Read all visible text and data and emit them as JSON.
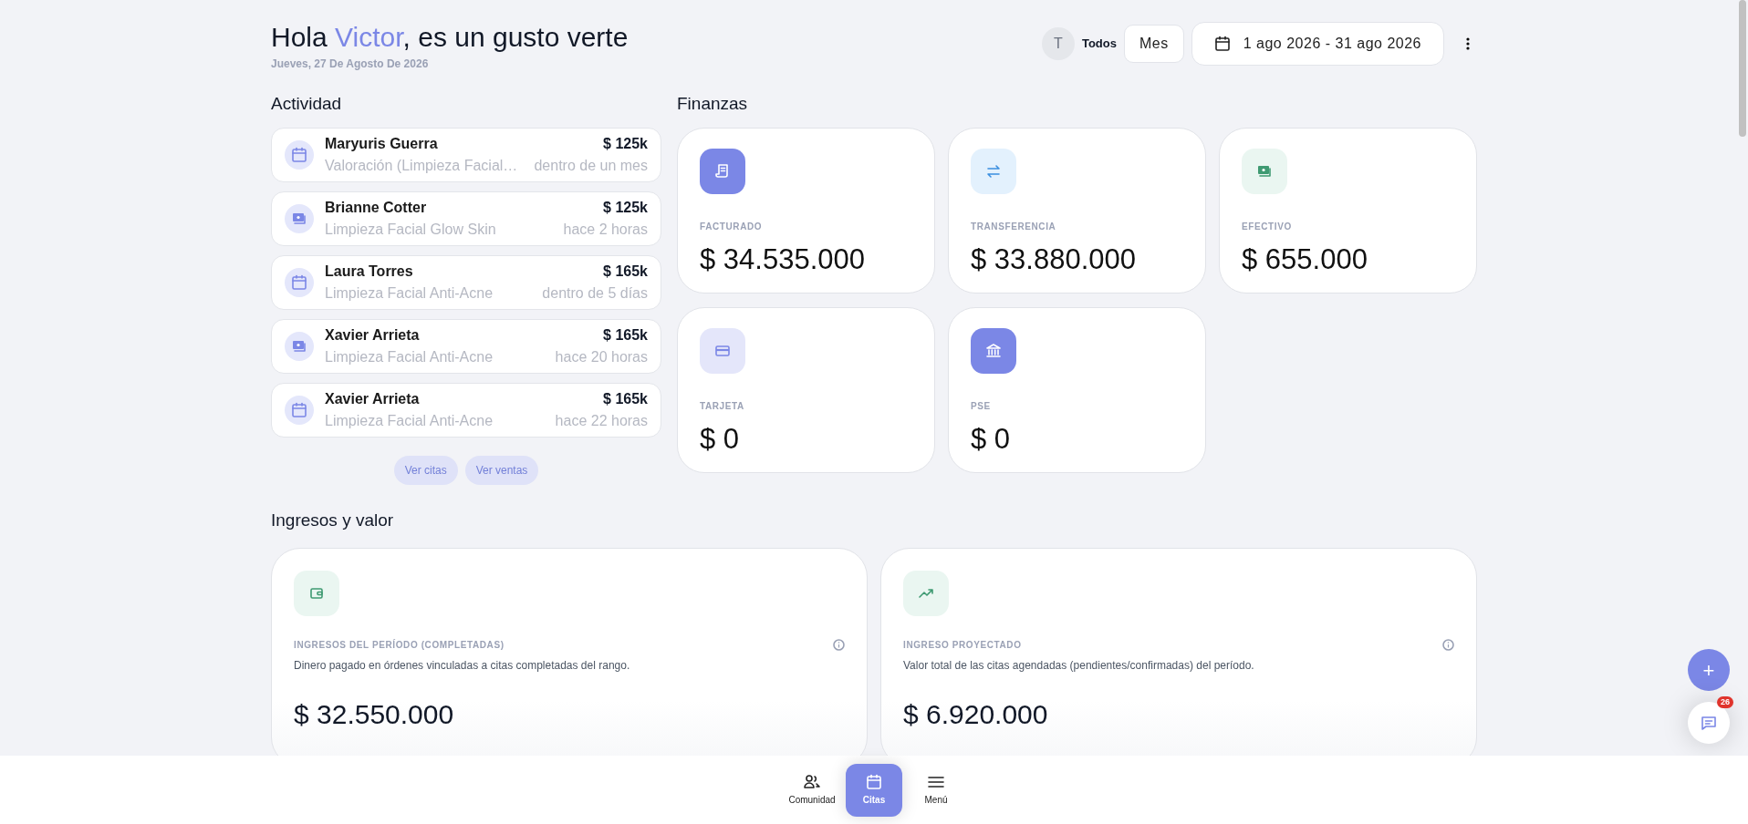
{
  "header": {
    "greeting_prefix": "Hola ",
    "user_name": "Victor",
    "greeting_suffix": ", es un gusto verte",
    "date": "Jueves, 27 De Agosto De 2026"
  },
  "filters": {
    "avatar_initial": "T",
    "scope": "Todos",
    "period": "Mes",
    "date_range": "1 ago 2026 - 31 ago 2026"
  },
  "activity": {
    "title": "Actividad",
    "items": [
      {
        "kind": "appointment",
        "name": "Maryuris Guerra",
        "amount": "$ 125k",
        "service": "Valoración (Limpieza Facial…",
        "time": "dentro de un mes"
      },
      {
        "kind": "sale",
        "name": "Brianne Cotter",
        "amount": "$ 125k",
        "service": "Limpieza Facial Glow Skin",
        "time": "hace 2 horas"
      },
      {
        "kind": "appointment",
        "name": "Laura Torres",
        "amount": "$ 165k",
        "service": "Limpieza Facial Anti-Acne",
        "time": "dentro de 5 días"
      },
      {
        "kind": "sale",
        "name": "Xavier Arrieta",
        "amount": "$ 165k",
        "service": "Limpieza Facial Anti-Acne",
        "time": "hace 20 horas"
      },
      {
        "kind": "appointment",
        "name": "Xavier Arrieta",
        "amount": "$ 165k",
        "service": "Limpieza Facial Anti-Acne",
        "time": "hace 22 horas"
      }
    ],
    "buttons": [
      "Ver citas",
      "Ver ventas"
    ]
  },
  "finances": {
    "title": "Finanzas",
    "cards": [
      {
        "label": "FACTURADO",
        "value": "$ 34.535.000"
      },
      {
        "label": "TRANSFERENCIA",
        "value": "$ 33.880.000"
      },
      {
        "label": "EFECTIVO",
        "value": "$ 655.000"
      },
      {
        "label": "TARJETA",
        "value": "$ 0"
      },
      {
        "label": "PSE",
        "value": "$ 0"
      }
    ]
  },
  "income": {
    "title": "Ingresos y valor",
    "cards": [
      {
        "label": "INGRESOS DEL PERÍODO (COMPLETADAS)",
        "description": "Dinero pagado en órdenes vinculadas a citas completadas del rango.",
        "value": "$ 32.550.000"
      },
      {
        "label": "INGRESO PROYECTADO",
        "description": "Valor total de las citas agendadas (pendientes/confirmadas) del período.",
        "value": "$ 6.920.000"
      }
    ]
  },
  "bottom_nav": [
    {
      "label": "Comunidad",
      "selected": false
    },
    {
      "label": "Citas",
      "selected": true
    },
    {
      "label": "Menú",
      "selected": false
    }
  ],
  "fab": {
    "label": "+"
  },
  "chat": {
    "badge": "26"
  }
}
